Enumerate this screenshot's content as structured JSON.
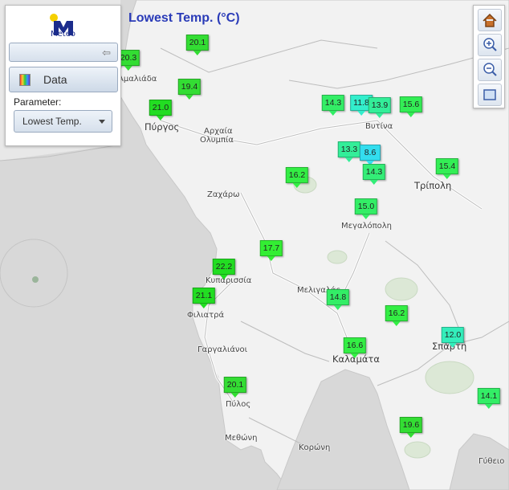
{
  "title": "Lowest Temp. (°C)",
  "panel": {
    "logo_text": "Meteo",
    "data_button": "Data",
    "parameter_label": "Parameter:",
    "parameter_value": "Lowest Temp."
  },
  "toolbar": [
    "home-icon",
    "zoom-in-icon",
    "zoom-out-icon",
    "extent-icon"
  ],
  "places": [
    {
      "name": "Αμαλιάδα",
      "major": false
    },
    {
      "name": "Πύργος",
      "major": true
    },
    {
      "name": "Αρχαία",
      "major": false
    },
    {
      "name": "Ολυμπία",
      "major": false
    },
    {
      "name": "Ζαχάρω",
      "major": false
    },
    {
      "name": "Βυτίνα",
      "major": false
    },
    {
      "name": "Τρίπολη",
      "major": true
    },
    {
      "name": "Μεγαλόπολη",
      "major": false
    },
    {
      "name": "Κυπαρισσία",
      "major": false
    },
    {
      "name": "Μελιγαλάς",
      "major": false
    },
    {
      "name": "Φιλιατρά",
      "major": false
    },
    {
      "name": "Γαργαλιάνοι",
      "major": false
    },
    {
      "name": "Καλαμάτα",
      "major": true
    },
    {
      "name": "Σπάρτη",
      "major": true
    },
    {
      "name": "Πύλος",
      "major": false
    },
    {
      "name": "Μεθώνη",
      "major": false
    },
    {
      "name": "Κορώνη",
      "major": false
    },
    {
      "name": "Γύθειο",
      "major": false
    }
  ],
  "markers": [
    {
      "value": "20.3",
      "color": "#33dd33"
    },
    {
      "value": "20.1",
      "color": "#33dd33"
    },
    {
      "value": "19.4",
      "color": "#33dd33"
    },
    {
      "value": "21.0",
      "color": "#22dd22"
    },
    {
      "value": "14.3",
      "color": "#33ee66"
    },
    {
      "value": "11.8",
      "color": "#33eecc"
    },
    {
      "value": "13.9",
      "color": "#33ee99"
    },
    {
      "value": "15.6",
      "color": "#33ee55"
    },
    {
      "value": "13.3",
      "color": "#33ee99"
    },
    {
      "value": "8.6",
      "color": "#33ddee"
    },
    {
      "value": "14.3",
      "color": "#33ee77"
    },
    {
      "value": "16.2",
      "color": "#33ee44"
    },
    {
      "value": "15.4",
      "color": "#33ee55"
    },
    {
      "value": "15.0",
      "color": "#33ee66"
    },
    {
      "value": "17.7",
      "color": "#33ee33"
    },
    {
      "value": "22.2",
      "color": "#22dd22"
    },
    {
      "value": "21.1",
      "color": "#22dd22"
    },
    {
      "value": "14.8",
      "color": "#33ee66"
    },
    {
      "value": "16.2",
      "color": "#33ee44"
    },
    {
      "value": "12.0",
      "color": "#33eebb"
    },
    {
      "value": "16.6",
      "color": "#33ee44"
    },
    {
      "value": "20.1",
      "color": "#33dd33"
    },
    {
      "value": "14.1",
      "color": "#33ee66"
    },
    {
      "value": "19.6",
      "color": "#33dd33"
    }
  ]
}
